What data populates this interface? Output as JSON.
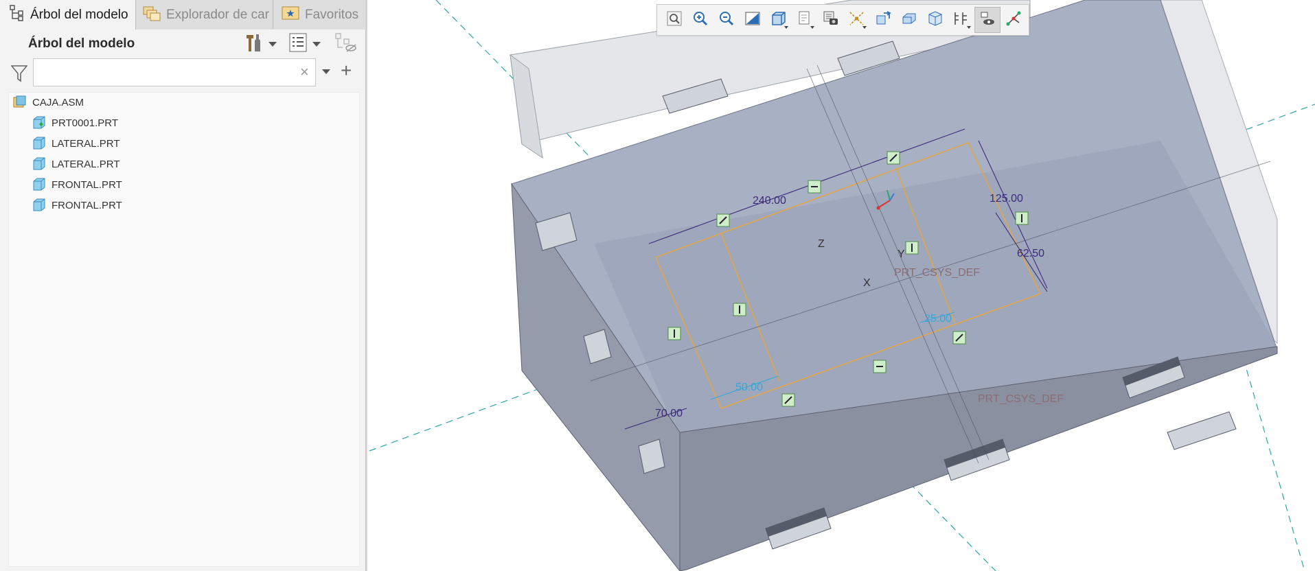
{
  "left_panel": {
    "tabs": [
      {
        "label": "Árbol del modelo",
        "icon": "model-tree-icon"
      },
      {
        "label": "Explorador de car",
        "icon": "folder-browser-icon"
      },
      {
        "label": "Favoritos",
        "icon": "favorites-icon"
      }
    ],
    "tree_title": "Árbol del modelo",
    "search": {
      "value": "",
      "placeholder": ""
    },
    "tree_items": [
      {
        "label": "CAJA.ASM",
        "icon": "assembly-icon"
      },
      {
        "label": "PRT0001.PRT",
        "icon": "active-part-icon"
      },
      {
        "label": "LATERAL.PRT",
        "icon": "part-icon"
      },
      {
        "label": "LATERAL.PRT",
        "icon": "part-icon"
      },
      {
        "label": "FRONTAL.PRT",
        "icon": "part-icon"
      },
      {
        "label": "FRONTAL.PRT",
        "icon": "part-icon"
      }
    ]
  },
  "view_toolbar": {
    "buttons": [
      {
        "name": "refit-icon"
      },
      {
        "name": "zoom-in-icon"
      },
      {
        "name": "zoom-out-icon"
      },
      {
        "name": "repaint-icon"
      },
      {
        "name": "display-style-icon"
      },
      {
        "name": "saved-orientations-icon"
      },
      {
        "name": "view-manager-icon"
      },
      {
        "name": "datum-display-icon"
      },
      {
        "name": "annotation-display-icon"
      },
      {
        "name": "section-icon"
      },
      {
        "name": "perspective-icon"
      },
      {
        "name": "sketch-display-icon"
      },
      {
        "name": "sketch-view-icon"
      },
      {
        "name": "constraints-icon"
      }
    ]
  },
  "viewport": {
    "dimensions": {
      "d240": "240.00",
      "d125": "125.00",
      "d6250": "62.50",
      "d25": "25.00",
      "d50": "50.00",
      "d70": "70.00"
    },
    "csys_label": "PRT_CSYS_DEF",
    "axis_x": "X",
    "axis_y": "Y",
    "axis_z": "Z",
    "colors": {
      "sketch_line": "#e0a64a",
      "dimension": "#3b2b79",
      "weak_dimension": "#35a7d8",
      "datum": "#2aa6a6",
      "part_top": "#a8b0c4",
      "part_front": "#8a909f"
    }
  }
}
